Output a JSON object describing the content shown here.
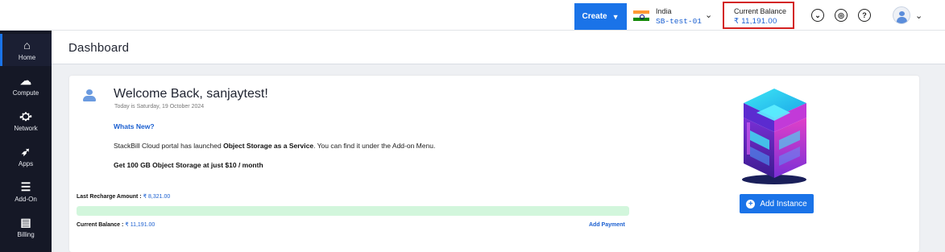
{
  "header": {
    "create_label": "Create",
    "region": {
      "country": "India",
      "project": "SB-test-01"
    },
    "balance": {
      "label": "Current Balance",
      "amount": "₹ 11,191.00"
    },
    "icons": [
      "chevron-circle-icon",
      "support-icon",
      "help-icon"
    ],
    "help_glyph": "?"
  },
  "sidebar": {
    "items": [
      {
        "label": "Home",
        "icon": "home-icon",
        "glyph": "⌂",
        "active": true
      },
      {
        "label": "Compute",
        "icon": "cloud-icon",
        "glyph": "☁",
        "active": false
      },
      {
        "label": "Network",
        "icon": "network-icon",
        "glyph": "⛮",
        "active": false
      },
      {
        "label": "Apps",
        "icon": "rocket-icon",
        "glyph": "➶",
        "active": false
      },
      {
        "label": "Add-On",
        "icon": "add-list-icon",
        "glyph": "☰",
        "active": false
      },
      {
        "label": "Billing",
        "icon": "receipt-icon",
        "glyph": "▤",
        "active": false
      }
    ]
  },
  "page": {
    "title": "Dashboard"
  },
  "welcome": {
    "title": "Welcome Back, sanjaytest!",
    "date": "Today is Saturday, 19 October 2024",
    "whats_new": "Whats New?",
    "announce_prefix": "StackBill Cloud portal has launched ",
    "announce_bold": "Object Storage as a Service",
    "announce_suffix": ". You can find it under the Add-on Menu.",
    "offer": "Get 100 GB Object Storage at just $10 / month"
  },
  "account": {
    "last_recharge_label": "Last Recharge Amount : ",
    "last_recharge_value": "₹ 8,321.00",
    "current_balance_label": "Current Balance : ",
    "current_balance_value": "₹ 11,191.00",
    "balance_fraction": 1.0,
    "add_payment": "Add Payment"
  },
  "actions": {
    "add_instance": "Add Instance"
  },
  "colors": {
    "accent": "#1a73e8",
    "sidebar": "#151826",
    "highlight": "#d32020",
    "progress": "#d2f6dc"
  }
}
